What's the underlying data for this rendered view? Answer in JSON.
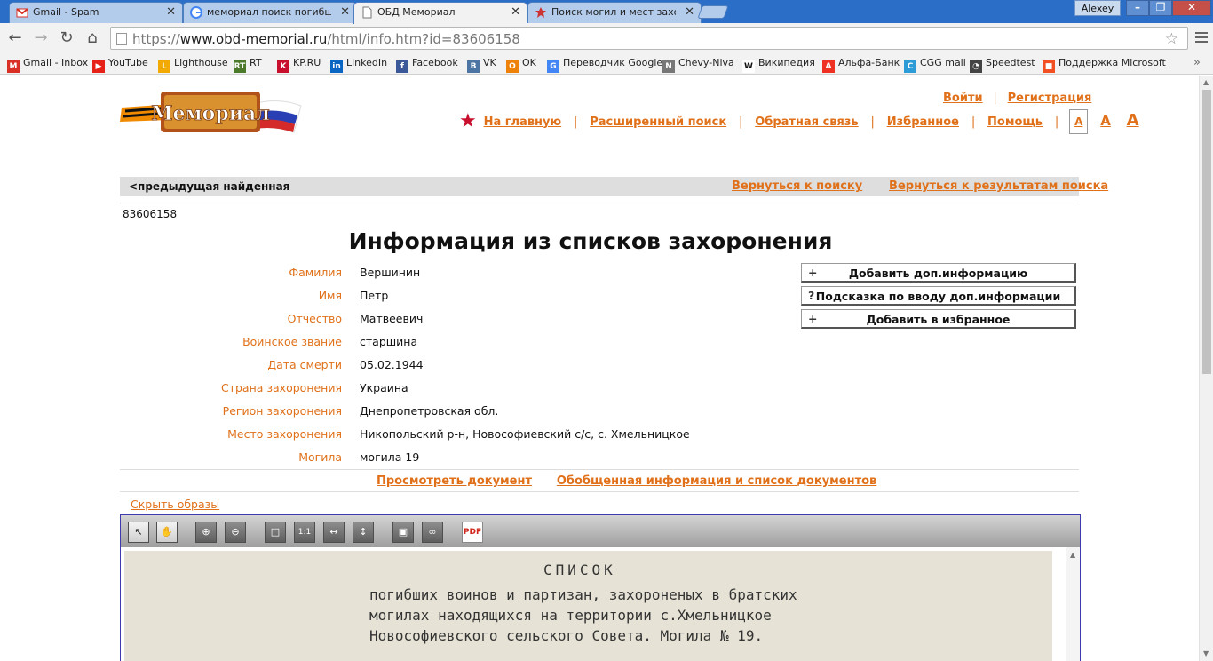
{
  "browser": {
    "tabs": [
      {
        "title": "Gmail - Spam",
        "icon": "gmail-icon"
      },
      {
        "title": "мемориал поиск погибших - Поиск в Google",
        "icon": "google-icon"
      },
      {
        "title": "ОБД Мемориал",
        "icon": "page-icon"
      },
      {
        "title": "Поиск могил и мест захоронения",
        "icon": "memorial-icon"
      }
    ],
    "user": "Alexey",
    "url_scheme": "https://",
    "url_host": "www.obd-memorial.ru",
    "url_path": "/html/info.htm?id=83606158",
    "bookmarks": [
      {
        "label": "Gmail - Inbox",
        "icon": "gmail-icon",
        "color": "#d93025",
        "glyph": "M"
      },
      {
        "label": "YouTube",
        "icon": "youtube-icon",
        "color": "#e62117",
        "glyph": "▶"
      },
      {
        "label": "Lighthouse",
        "icon": "lighthouse-icon",
        "color": "#f2a900",
        "glyph": "L"
      },
      {
        "label": "RT",
        "icon": "rt-icon",
        "color": "#4b7a2a",
        "glyph": "RT"
      },
      {
        "label": "KP.RU",
        "icon": "kp-icon",
        "color": "#c8102e",
        "glyph": "K"
      },
      {
        "label": "LinkedIn",
        "icon": "linkedin-icon",
        "color": "#0a66c2",
        "glyph": "in"
      },
      {
        "label": "Facebook",
        "icon": "facebook-icon",
        "color": "#3b5998",
        "glyph": "f"
      },
      {
        "label": "VK",
        "icon": "vk-icon",
        "color": "#4c75a3",
        "glyph": "B"
      },
      {
        "label": "OK",
        "icon": "ok-icon",
        "color": "#ee8208",
        "glyph": "O"
      },
      {
        "label": "Переводчик Google",
        "icon": "translate-icon",
        "color": "#4285f4",
        "glyph": "G"
      },
      {
        "label": "Chevy-Niva",
        "icon": "niva-icon",
        "color": "#777777",
        "glyph": "N"
      },
      {
        "label": "Википедия",
        "icon": "wikipedia-icon",
        "color": "#ffffff",
        "glyph": "W"
      },
      {
        "label": "Альфа-Банк",
        "icon": "alfabank-icon",
        "color": "#ef3124",
        "glyph": "А"
      },
      {
        "label": "CGG mail",
        "icon": "cgg-icon",
        "color": "#2c9bd6",
        "glyph": "C"
      },
      {
        "label": "Speedtest",
        "icon": "speedtest-icon",
        "color": "#444444",
        "glyph": "◔"
      },
      {
        "label": "Поддержка Microsoft",
        "icon": "microsoft-icon",
        "color": "#f25022",
        "glyph": "■"
      }
    ]
  },
  "site": {
    "logo_text": "Мемориал",
    "login": "Войти",
    "register": "Регистрация",
    "nav": [
      "На главную",
      "Расширенный поиск",
      "Обратная связь",
      "Избранное",
      "Помощь"
    ],
    "font_sizes": [
      "A",
      "A",
      "A"
    ],
    "accent_color": "#e0711a"
  },
  "record": {
    "prev": "<предыдущая найденная",
    "back_search": "Вернуться к поиску",
    "back_results": "Вернуться к результатам поиска",
    "id": "83606158",
    "title": "Информация из списков захоронения",
    "fields": [
      {
        "label": "Фамилия",
        "value": "Вершинин"
      },
      {
        "label": "Имя",
        "value": "Петр"
      },
      {
        "label": "Отчество",
        "value": "Матвеевич"
      },
      {
        "label": "Воинское звание",
        "value": "старшина"
      },
      {
        "label": "Дата смерти",
        "value": "05.02.1944"
      },
      {
        "label": "Страна захоронения",
        "value": "Украина"
      },
      {
        "label": "Регион захоронения",
        "value": "Днепропетровская обл."
      },
      {
        "label": "Место захоронения",
        "value": "Никопольский р-н, Новософиевский с/с, с. Хмельницкое"
      },
      {
        "label": "Могила",
        "value": "могила 19"
      }
    ],
    "actions": [
      {
        "sign": "+",
        "label": "Добавить доп.информацию"
      },
      {
        "sign": "?",
        "label": "Подсказка по вводу доп.информации"
      },
      {
        "sign": "+",
        "label": "Добавить в избранное"
      }
    ],
    "view_doc": "Просмотреть документ",
    "summary": "Обобщенная информация и список документов",
    "hide_images": "Скрыть образы"
  },
  "viewer": {
    "tools": [
      "select-tool",
      "hand-tool",
      "zoom-in",
      "zoom-out",
      "fit-page",
      "actual-size",
      "fit-width",
      "fit-height",
      "save",
      "link",
      "pdf"
    ],
    "doc_lines": [
      "СПИСОК",
      "погибших воинов и партизан, захороненых в братских",
      "могилах находящихся на территории с.Хмельницкое",
      "Новософиевского сельского Совета. Могила № 19."
    ]
  }
}
